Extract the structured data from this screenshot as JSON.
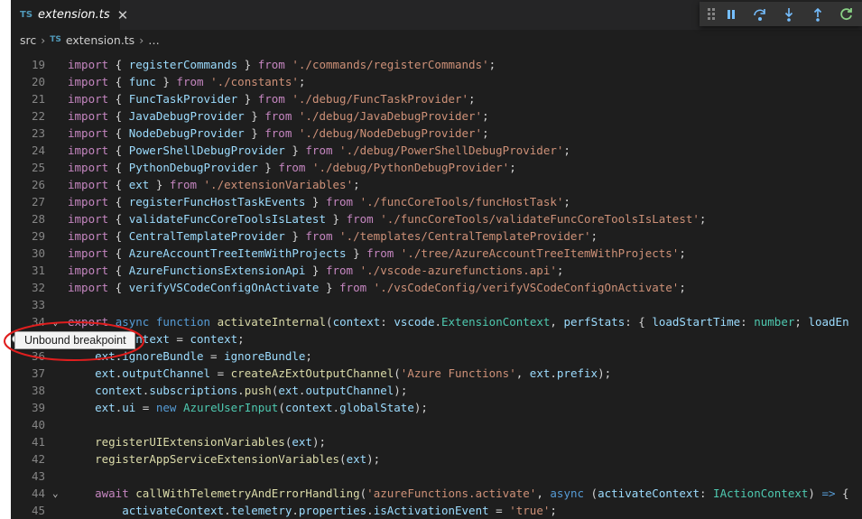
{
  "tab": {
    "badge": "TS",
    "title": "extension.ts",
    "close": "✕"
  },
  "breadcrumb": {
    "folder": "src",
    "badge": "TS",
    "file": "extension.ts",
    "more": "…",
    "sep": "›"
  },
  "debug_toolbar": {
    "actions": [
      {
        "name": "pause",
        "icon": "pause-icon",
        "color": "#75beff"
      },
      {
        "name": "step-over",
        "icon": "step-over-icon",
        "color": "#75beff"
      },
      {
        "name": "step-into",
        "icon": "step-into-icon",
        "color": "#75beff"
      },
      {
        "name": "step-out",
        "icon": "step-out-icon",
        "color": "#75beff"
      },
      {
        "name": "restart",
        "icon": "restart-icon",
        "color": "#89d185"
      }
    ]
  },
  "tooltip": {
    "text": "Unbound breakpoint"
  },
  "code_lines": [
    {
      "n": "19",
      "tokens": [
        [
          "kc",
          "import"
        ],
        [
          "pun",
          " { "
        ],
        [
          "var",
          "registerCommands"
        ],
        [
          "pun",
          " } "
        ],
        [
          "kc",
          "from"
        ],
        [
          "pun",
          " "
        ],
        [
          "str",
          "'./commands/registerCommands'"
        ],
        [
          "pun",
          ";"
        ]
      ]
    },
    {
      "n": "20",
      "tokens": [
        [
          "kc",
          "import"
        ],
        [
          "pun",
          " { "
        ],
        [
          "var",
          "func"
        ],
        [
          "pun",
          " } "
        ],
        [
          "kc",
          "from"
        ],
        [
          "pun",
          " "
        ],
        [
          "str",
          "'./constants'"
        ],
        [
          "pun",
          ";"
        ]
      ]
    },
    {
      "n": "21",
      "tokens": [
        [
          "kc",
          "import"
        ],
        [
          "pun",
          " { "
        ],
        [
          "var",
          "FuncTaskProvider"
        ],
        [
          "pun",
          " } "
        ],
        [
          "kc",
          "from"
        ],
        [
          "pun",
          " "
        ],
        [
          "str",
          "'./debug/FuncTaskProvider'"
        ],
        [
          "pun",
          ";"
        ]
      ]
    },
    {
      "n": "22",
      "tokens": [
        [
          "kc",
          "import"
        ],
        [
          "pun",
          " { "
        ],
        [
          "var",
          "JavaDebugProvider"
        ],
        [
          "pun",
          " } "
        ],
        [
          "kc",
          "from"
        ],
        [
          "pun",
          " "
        ],
        [
          "str",
          "'./debug/JavaDebugProvider'"
        ],
        [
          "pun",
          ";"
        ]
      ]
    },
    {
      "n": "23",
      "tokens": [
        [
          "kc",
          "import"
        ],
        [
          "pun",
          " { "
        ],
        [
          "var",
          "NodeDebugProvider"
        ],
        [
          "pun",
          " } "
        ],
        [
          "kc",
          "from"
        ],
        [
          "pun",
          " "
        ],
        [
          "str",
          "'./debug/NodeDebugProvider'"
        ],
        [
          "pun",
          ";"
        ]
      ]
    },
    {
      "n": "24",
      "tokens": [
        [
          "kc",
          "import"
        ],
        [
          "pun",
          " { "
        ],
        [
          "var",
          "PowerShellDebugProvider"
        ],
        [
          "pun",
          " } "
        ],
        [
          "kc",
          "from"
        ],
        [
          "pun",
          " "
        ],
        [
          "str",
          "'./debug/PowerShellDebugProvider'"
        ],
        [
          "pun",
          ";"
        ]
      ]
    },
    {
      "n": "25",
      "tokens": [
        [
          "kc",
          "import"
        ],
        [
          "pun",
          " { "
        ],
        [
          "var",
          "PythonDebugProvider"
        ],
        [
          "pun",
          " } "
        ],
        [
          "kc",
          "from"
        ],
        [
          "pun",
          " "
        ],
        [
          "str",
          "'./debug/PythonDebugProvider'"
        ],
        [
          "pun",
          ";"
        ]
      ]
    },
    {
      "n": "26",
      "tokens": [
        [
          "kc",
          "import"
        ],
        [
          "pun",
          " { "
        ],
        [
          "var",
          "ext"
        ],
        [
          "pun",
          " } "
        ],
        [
          "kc",
          "from"
        ],
        [
          "pun",
          " "
        ],
        [
          "str",
          "'./extensionVariables'"
        ],
        [
          "pun",
          ";"
        ]
      ]
    },
    {
      "n": "27",
      "tokens": [
        [
          "kc",
          "import"
        ],
        [
          "pun",
          " { "
        ],
        [
          "var",
          "registerFuncHostTaskEvents"
        ],
        [
          "pun",
          " } "
        ],
        [
          "kc",
          "from"
        ],
        [
          "pun",
          " "
        ],
        [
          "str",
          "'./funcCoreTools/funcHostTask'"
        ],
        [
          "pun",
          ";"
        ]
      ]
    },
    {
      "n": "28",
      "tokens": [
        [
          "kc",
          "import"
        ],
        [
          "pun",
          " { "
        ],
        [
          "var",
          "validateFuncCoreToolsIsLatest"
        ],
        [
          "pun",
          " } "
        ],
        [
          "kc",
          "from"
        ],
        [
          "pun",
          " "
        ],
        [
          "str",
          "'./funcCoreTools/validateFuncCoreToolsIsLatest'"
        ],
        [
          "pun",
          ";"
        ]
      ]
    },
    {
      "n": "29",
      "tokens": [
        [
          "kc",
          "import"
        ],
        [
          "pun",
          " { "
        ],
        [
          "var",
          "CentralTemplateProvider"
        ],
        [
          "pun",
          " } "
        ],
        [
          "kc",
          "from"
        ],
        [
          "pun",
          " "
        ],
        [
          "str",
          "'./templates/CentralTemplateProvider'"
        ],
        [
          "pun",
          ";"
        ]
      ]
    },
    {
      "n": "30",
      "tokens": [
        [
          "kc",
          "import"
        ],
        [
          "pun",
          " { "
        ],
        [
          "var",
          "AzureAccountTreeItemWithProjects"
        ],
        [
          "pun",
          " } "
        ],
        [
          "kc",
          "from"
        ],
        [
          "pun",
          " "
        ],
        [
          "str",
          "'./tree/AzureAccountTreeItemWithProjects'"
        ],
        [
          "pun",
          ";"
        ]
      ]
    },
    {
      "n": "31",
      "tokens": [
        [
          "kc",
          "import"
        ],
        [
          "pun",
          " { "
        ],
        [
          "var",
          "AzureFunctionsExtensionApi"
        ],
        [
          "pun",
          " } "
        ],
        [
          "kc",
          "from"
        ],
        [
          "pun",
          " "
        ],
        [
          "str",
          "'./vscode-azurefunctions.api'"
        ],
        [
          "pun",
          ";"
        ]
      ]
    },
    {
      "n": "32",
      "tokens": [
        [
          "kc",
          "import"
        ],
        [
          "pun",
          " { "
        ],
        [
          "var",
          "verifyVSCodeConfigOnActivate"
        ],
        [
          "pun",
          " } "
        ],
        [
          "kc",
          "from"
        ],
        [
          "pun",
          " "
        ],
        [
          "str",
          "'./vsCodeConfig/verifyVSCodeConfigOnActivate'"
        ],
        [
          "pun",
          ";"
        ]
      ]
    },
    {
      "n": "33",
      "tokens": []
    },
    {
      "n": "34",
      "fold": true,
      "tokens": [
        [
          "kc",
          "export"
        ],
        [
          "pun",
          " "
        ],
        [
          "kw",
          "async"
        ],
        [
          "pun",
          " "
        ],
        [
          "kw",
          "function"
        ],
        [
          "pun",
          " "
        ],
        [
          "fn",
          "activateInternal"
        ],
        [
          "pun",
          "("
        ],
        [
          "var",
          "context"
        ],
        [
          "pun",
          ": "
        ],
        [
          "var",
          "vscode"
        ],
        [
          "pun",
          "."
        ],
        [
          "ty",
          "ExtensionContext"
        ],
        [
          "pun",
          ", "
        ],
        [
          "var",
          "perfStats"
        ],
        [
          "pun",
          ": { "
        ],
        [
          "var",
          "loadStartTime"
        ],
        [
          "pun",
          ": "
        ],
        [
          "ty",
          "number"
        ],
        [
          "pun",
          "; "
        ],
        [
          "var",
          "loadEn"
        ]
      ]
    },
    {
      "n": "35",
      "tokens": [
        [
          "pun",
          "    "
        ],
        [
          "var",
          "ext"
        ],
        [
          "pun",
          "."
        ],
        [
          "var",
          "context"
        ],
        [
          "pun",
          " = "
        ],
        [
          "var",
          "context"
        ],
        [
          "pun",
          ";"
        ]
      ]
    },
    {
      "n": "36",
      "tokens": [
        [
          "pun",
          "    "
        ],
        [
          "var",
          "ext"
        ],
        [
          "pun",
          "."
        ],
        [
          "var",
          "ignoreBundle"
        ],
        [
          "pun",
          " = "
        ],
        [
          "var",
          "ignoreBundle"
        ],
        [
          "pun",
          ";"
        ]
      ]
    },
    {
      "n": "37",
      "tokens": [
        [
          "pun",
          "    "
        ],
        [
          "var",
          "ext"
        ],
        [
          "pun",
          "."
        ],
        [
          "var",
          "outputChannel"
        ],
        [
          "pun",
          " = "
        ],
        [
          "fn",
          "createAzExtOutputChannel"
        ],
        [
          "pun",
          "("
        ],
        [
          "str",
          "'Azure Functions'"
        ],
        [
          "pun",
          ", "
        ],
        [
          "var",
          "ext"
        ],
        [
          "pun",
          "."
        ],
        [
          "var",
          "prefix"
        ],
        [
          "pun",
          ");"
        ]
      ]
    },
    {
      "n": "38",
      "tokens": [
        [
          "pun",
          "    "
        ],
        [
          "var",
          "context"
        ],
        [
          "pun",
          "."
        ],
        [
          "var",
          "subscriptions"
        ],
        [
          "pun",
          "."
        ],
        [
          "fn",
          "push"
        ],
        [
          "pun",
          "("
        ],
        [
          "var",
          "ext"
        ],
        [
          "pun",
          "."
        ],
        [
          "var",
          "outputChannel"
        ],
        [
          "pun",
          ");"
        ]
      ]
    },
    {
      "n": "39",
      "tokens": [
        [
          "pun",
          "    "
        ],
        [
          "var",
          "ext"
        ],
        [
          "pun",
          "."
        ],
        [
          "var",
          "ui"
        ],
        [
          "pun",
          " = "
        ],
        [
          "kw",
          "new"
        ],
        [
          "pun",
          " "
        ],
        [
          "ty",
          "AzureUserInput"
        ],
        [
          "pun",
          "("
        ],
        [
          "var",
          "context"
        ],
        [
          "pun",
          "."
        ],
        [
          "var",
          "globalState"
        ],
        [
          "pun",
          ");"
        ]
      ]
    },
    {
      "n": "40",
      "tokens": []
    },
    {
      "n": "41",
      "tokens": [
        [
          "pun",
          "    "
        ],
        [
          "fn",
          "registerUIExtensionVariables"
        ],
        [
          "pun",
          "("
        ],
        [
          "var",
          "ext"
        ],
        [
          "pun",
          ");"
        ]
      ]
    },
    {
      "n": "42",
      "tokens": [
        [
          "pun",
          "    "
        ],
        [
          "fn",
          "registerAppServiceExtensionVariables"
        ],
        [
          "pun",
          "("
        ],
        [
          "var",
          "ext"
        ],
        [
          "pun",
          ");"
        ]
      ]
    },
    {
      "n": "43",
      "tokens": []
    },
    {
      "n": "44",
      "fold": true,
      "tokens": [
        [
          "pun",
          "    "
        ],
        [
          "kc",
          "await"
        ],
        [
          "pun",
          " "
        ],
        [
          "fn",
          "callWithTelemetryAndErrorHandling"
        ],
        [
          "pun",
          "("
        ],
        [
          "str",
          "'azureFunctions.activate'"
        ],
        [
          "pun",
          ", "
        ],
        [
          "kw",
          "async"
        ],
        [
          "pun",
          " ("
        ],
        [
          "var",
          "activateContext"
        ],
        [
          "pun",
          ": "
        ],
        [
          "ty",
          "IActionContext"
        ],
        [
          "pun",
          ") "
        ],
        [
          "kw",
          "=>"
        ],
        [
          "pun",
          " {"
        ]
      ]
    },
    {
      "n": "45",
      "tokens": [
        [
          "pun",
          "        "
        ],
        [
          "var",
          "activateContext"
        ],
        [
          "pun",
          "."
        ],
        [
          "var",
          "telemetry"
        ],
        [
          "pun",
          "."
        ],
        [
          "var",
          "properties"
        ],
        [
          "pun",
          "."
        ],
        [
          "var",
          "isActivationEvent"
        ],
        [
          "pun",
          " = "
        ],
        [
          "str",
          "'true'"
        ],
        [
          "pun",
          ";"
        ]
      ]
    }
  ]
}
